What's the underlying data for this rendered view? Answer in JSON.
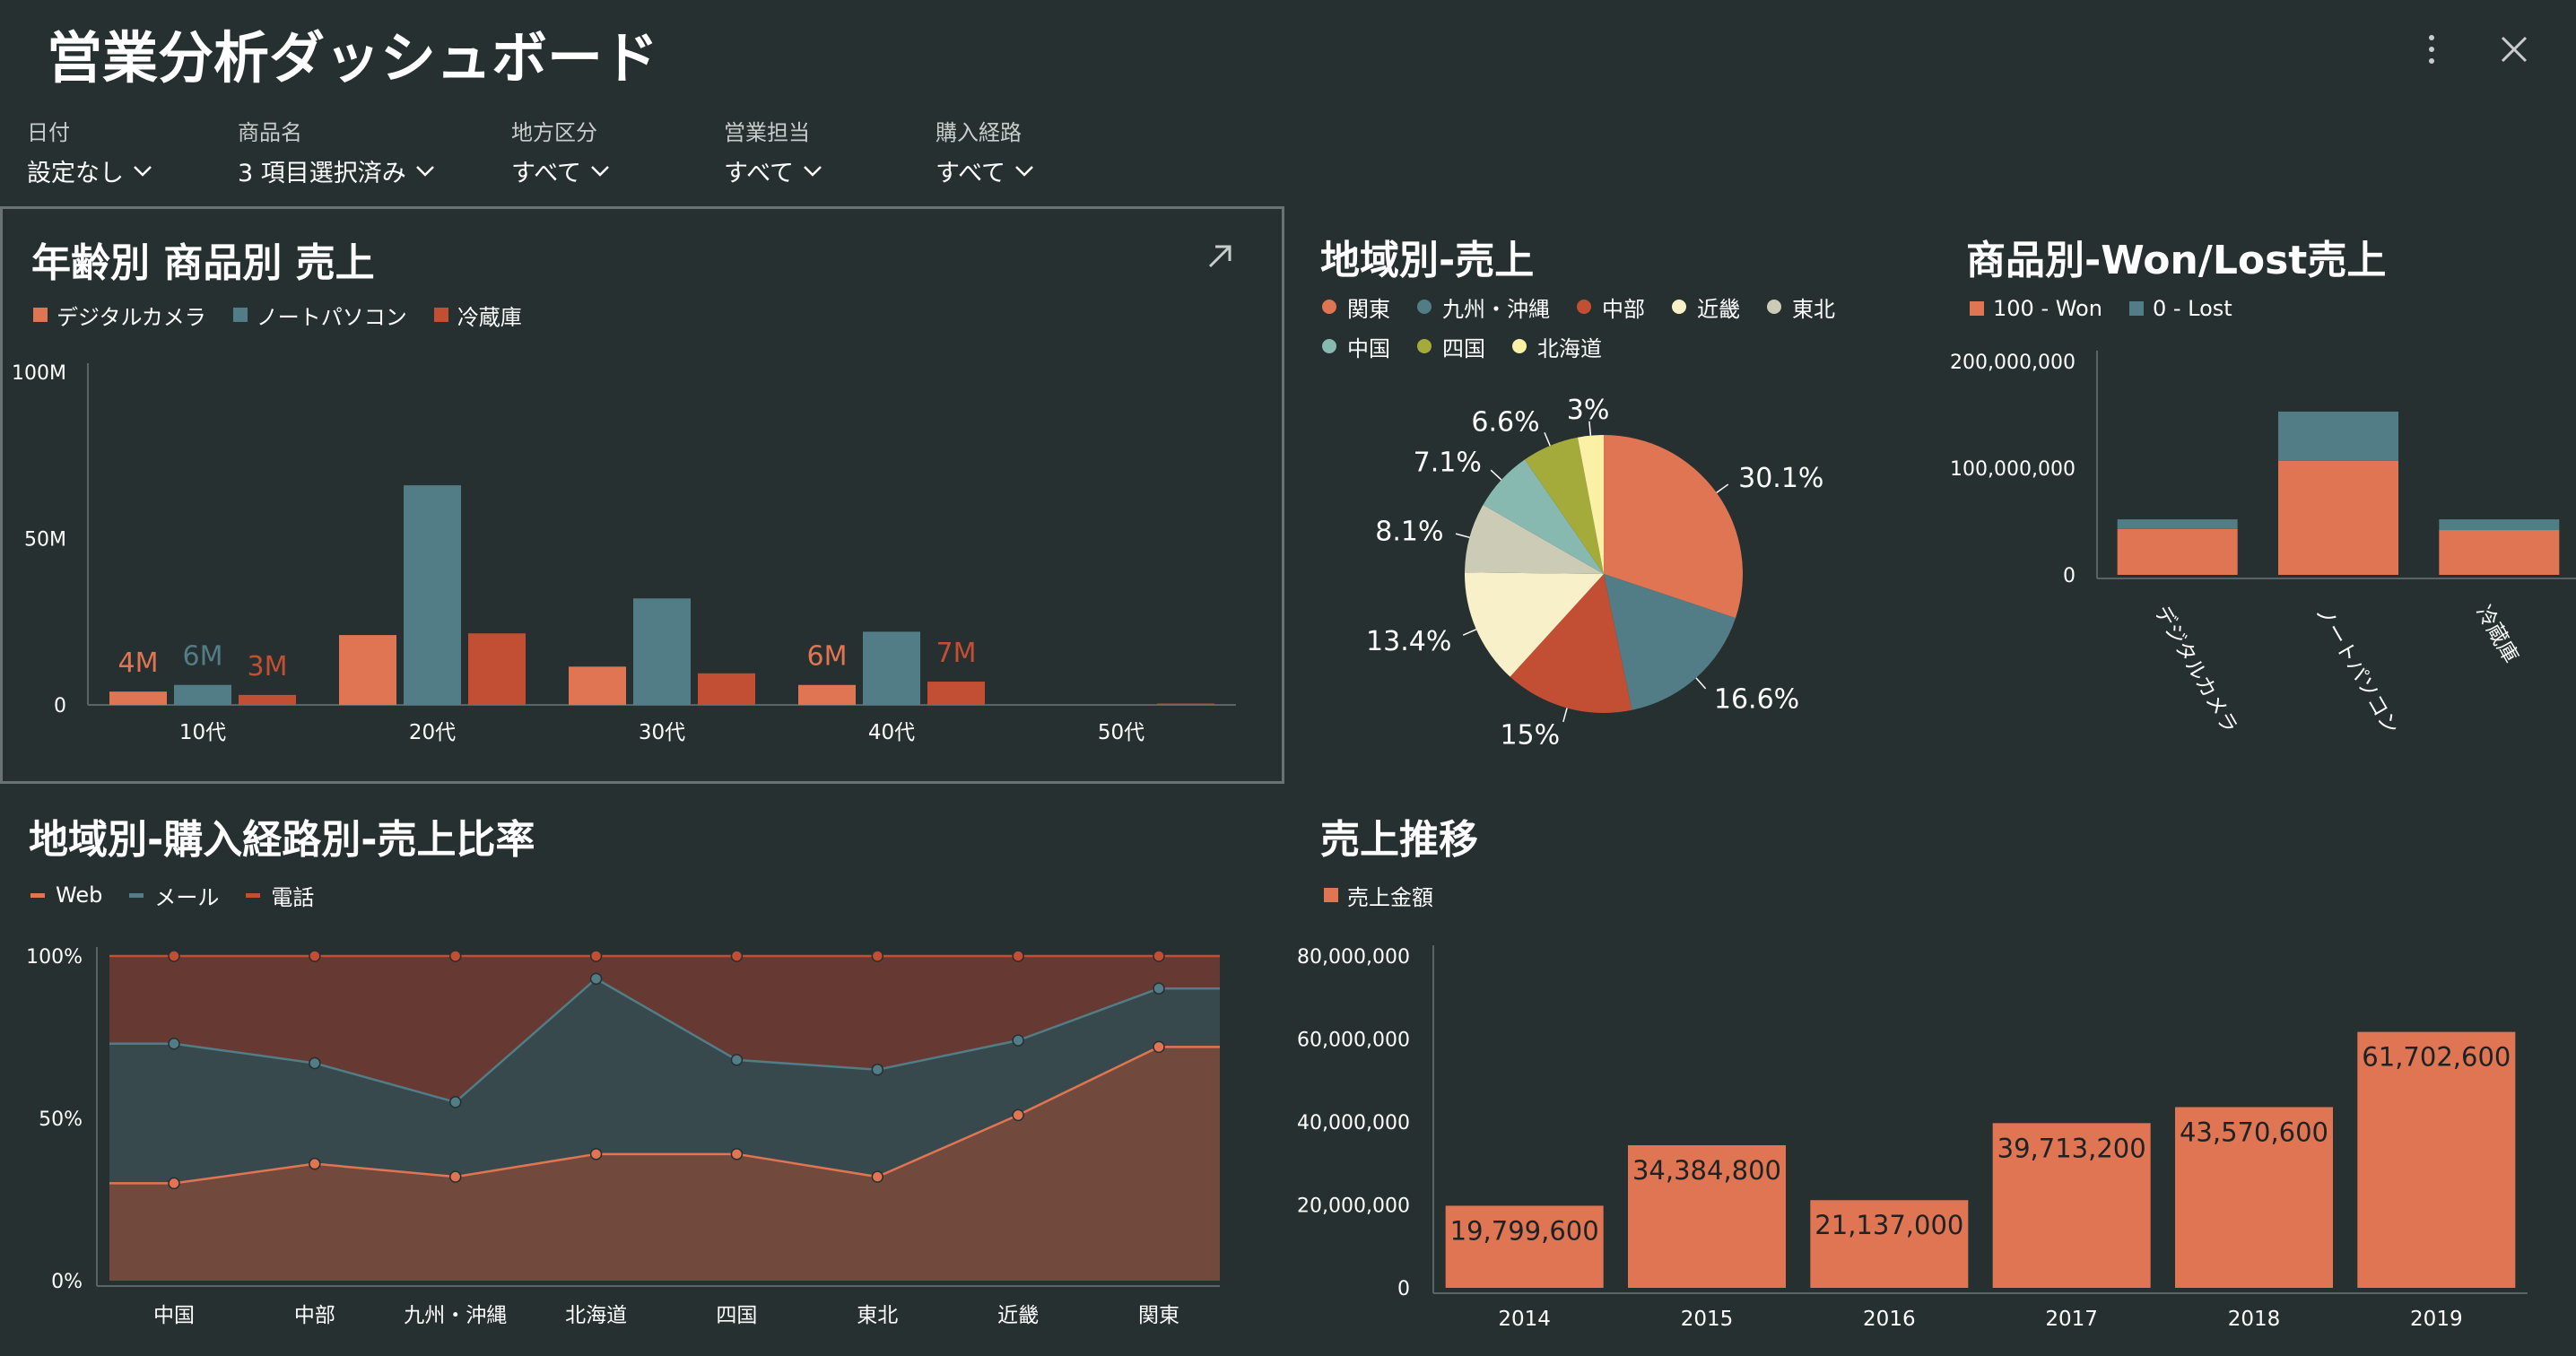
{
  "header": {
    "title": "営業分析ダッシュボード"
  },
  "filters": [
    {
      "label": "日付",
      "value": "設定なし"
    },
    {
      "label": "商品名",
      "value": "3 項目選択済み"
    },
    {
      "label": "地方区分",
      "value": "すべて"
    },
    {
      "label": "営業担当",
      "value": "すべて"
    },
    {
      "label": "購入経路",
      "value": "すべて"
    }
  ],
  "panels": {
    "age_product": {
      "title": "年齢別 商品別 売上",
      "legend": [
        "デジタルカメラ",
        "ノートパソコン",
        "冷蔵庫"
      ]
    },
    "region_sales": {
      "title": "地域別-売上",
      "legend": [
        "関東",
        "九州・沖縄",
        "中部",
        "近畿",
        "東北",
        "中国",
        "四国",
        "北海道"
      ]
    },
    "won_lost": {
      "title": "商品別-Won/Lost売上",
      "legend": [
        "100 - Won",
        "0 - Lost"
      ]
    },
    "channel_ratio": {
      "title": "地域別-購入経路別-売上比率",
      "legend": [
        "Web",
        "メール",
        "電話"
      ]
    },
    "sales_trend": {
      "title": "売上推移",
      "legend": [
        "売上金額"
      ]
    }
  },
  "colors": {
    "background": "#263030",
    "orange": "#e07553",
    "teal": "#527d86",
    "red": "#c24f33",
    "cream": "#f7f0c8",
    "beige": "#cccbb5",
    "mint": "#87b9b0",
    "olive": "#a5ab3b",
    "lightyellow": "#faf1a7"
  },
  "chart_data": [
    {
      "id": "age_product",
      "type": "bar",
      "categories": [
        "10代",
        "20代",
        "30代",
        "40代",
        "50代"
      ],
      "series": [
        {
          "name": "デジタルカメラ",
          "values": [
            4,
            21,
            11.5,
            6,
            0
          ]
        },
        {
          "name": "ノートパソコン",
          "values": [
            6,
            66,
            32,
            22,
            0
          ]
        },
        {
          "name": "冷蔵庫",
          "values": [
            3,
            21.5,
            9.5,
            7,
            0.4
          ]
        }
      ],
      "yticks": [
        "0",
        "50M",
        "100M"
      ],
      "ylim": [
        0,
        100
      ],
      "data_labels": [
        {
          "category": "10代",
          "series": "デジタルカメラ",
          "text": "4M"
        },
        {
          "category": "10代",
          "series": "ノートパソコン",
          "text": "6M"
        },
        {
          "category": "10代",
          "series": "冷蔵庫",
          "text": "3M"
        },
        {
          "category": "40代",
          "series": "デジタルカメラ",
          "text": "6M"
        },
        {
          "category": "40代",
          "series": "冷蔵庫",
          "text": "7M"
        }
      ]
    },
    {
      "id": "region_sales",
      "type": "pie",
      "slices": [
        {
          "label": "関東",
          "value": 30.1,
          "text": "30.1%"
        },
        {
          "label": "九州・沖縄",
          "value": 16.6,
          "text": "16.6%"
        },
        {
          "label": "中部",
          "value": 15,
          "text": "15%"
        },
        {
          "label": "近畿",
          "value": 13.4,
          "text": "13.4%"
        },
        {
          "label": "東北",
          "value": 8.1,
          "text": "8.1%"
        },
        {
          "label": "中国",
          "value": 7.1,
          "text": "7.1%"
        },
        {
          "label": "四国",
          "value": 6.6,
          "text": "6.6%"
        },
        {
          "label": "北海道",
          "value": 3,
          "text": "3%"
        }
      ]
    },
    {
      "id": "won_lost",
      "type": "bar",
      "stacked": true,
      "categories": [
        "デジタルカメラ",
        "ノートパソコン",
        "冷蔵庫"
      ],
      "series": [
        {
          "name": "100 - Won",
          "values": [
            43000000,
            107000000,
            42000000
          ]
        },
        {
          "name": "0 - Lost",
          "values": [
            9000000,
            46000000,
            10000000
          ]
        }
      ],
      "yticks": [
        "0",
        "100,000,000",
        "200,000,000"
      ],
      "ylim": [
        0,
        200000000
      ]
    },
    {
      "id": "channel_ratio",
      "type": "area",
      "stacked_percent": true,
      "categories": [
        "中国",
        "中部",
        "九州・沖縄",
        "北海道",
        "四国",
        "東北",
        "近畿",
        "関東"
      ],
      "series": [
        {
          "name": "Web",
          "values": [
            30,
            36,
            32,
            39,
            39,
            32,
            51,
            72
          ]
        },
        {
          "name": "メール",
          "values": [
            43,
            31,
            23,
            54,
            29,
            33,
            23,
            18
          ]
        },
        {
          "name": "電話",
          "values": [
            27,
            33,
            45,
            7,
            32,
            35,
            26,
            10
          ]
        }
      ],
      "yticks": [
        "0%",
        "50%",
        "100%"
      ],
      "ylim": [
        0,
        100
      ]
    },
    {
      "id": "sales_trend",
      "type": "bar",
      "categories": [
        "2014",
        "2015",
        "2016",
        "2017",
        "2018",
        "2019"
      ],
      "values": [
        19799600,
        34384800,
        21137000,
        39713200,
        43570600,
        61702600
      ],
      "value_labels": [
        "19,799,600",
        "34,384,800",
        "21,137,000",
        "39,713,200",
        "43,570,600",
        "61,702,600"
      ],
      "yticks": [
        "0",
        "20,000,000",
        "40,000,000",
        "60,000,000",
        "80,000,000"
      ],
      "ylim": [
        0,
        80000000
      ]
    }
  ]
}
